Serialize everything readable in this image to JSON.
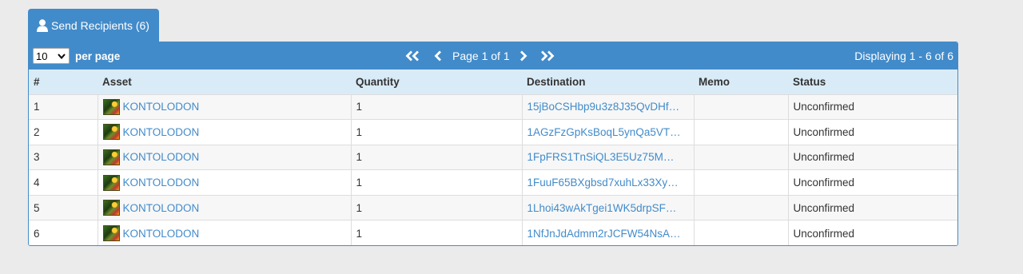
{
  "tab": {
    "label": "Send Recipients (6)"
  },
  "toolbar": {
    "per_page_value": "10",
    "per_page_label": "per page",
    "page_info": "Page 1 of 1",
    "displaying": "Displaying 1 - 6 of 6"
  },
  "table": {
    "headers": [
      "#",
      "Asset",
      "Quantity",
      "Destination",
      "Memo",
      "Status"
    ],
    "rows": [
      {
        "num": "1",
        "asset": "KONTOLODON",
        "quantity": "1",
        "destination": "15jBoCSHbp9u3z8J35QvDHf…",
        "memo": "",
        "status": "Unconfirmed"
      },
      {
        "num": "2",
        "asset": "KONTOLODON",
        "quantity": "1",
        "destination": "1AGzFzGpKsBoqL5ynQa5VT…",
        "memo": "",
        "status": "Unconfirmed"
      },
      {
        "num": "3",
        "asset": "KONTOLODON",
        "quantity": "1",
        "destination": "1FpFRS1TnSiQL3E5Uz75M…",
        "memo": "",
        "status": "Unconfirmed"
      },
      {
        "num": "4",
        "asset": "KONTOLODON",
        "quantity": "1",
        "destination": "1FuuF65BXgbsd7xuhLx33Xy…",
        "memo": "",
        "status": "Unconfirmed"
      },
      {
        "num": "5",
        "asset": "KONTOLODON",
        "quantity": "1",
        "destination": "1Lhoi43wAkTgei1WK5drpSF…",
        "memo": "",
        "status": "Unconfirmed"
      },
      {
        "num": "6",
        "asset": "KONTOLODON",
        "quantity": "1",
        "destination": "1NfJnJdAdmm2rJCFW54NsA…",
        "memo": "",
        "status": "Unconfirmed"
      }
    ]
  },
  "icons": {
    "tab": "user-icon",
    "first": "double-chevron-left-icon",
    "prev": "chevron-left-icon",
    "next": "chevron-right-icon",
    "last": "double-chevron-right-icon",
    "asset": "asset-thumbnail"
  },
  "colors": {
    "accent": "#428bca",
    "header_bg": "#d9ebf7",
    "link": "#428bca",
    "page_bg": "#ebebeb"
  }
}
